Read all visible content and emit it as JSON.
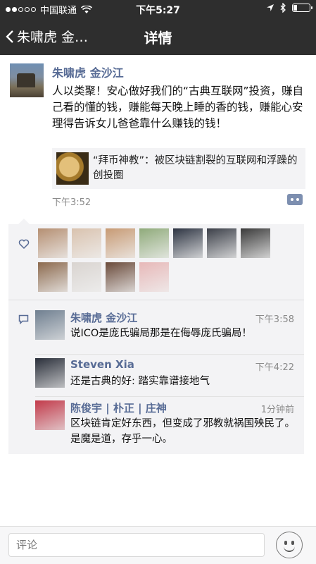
{
  "status_bar": {
    "carrier": "中国联通",
    "time": "下午5:27"
  },
  "nav": {
    "back_label": "朱啸虎 金…",
    "title": "详情"
  },
  "post": {
    "author": "朱啸虎 金沙江",
    "text": "人以类聚！安心做好我们的“古典互联网”投资，赚自己看的懂的钱，赚能每天晚上睡的香的钱，赚能心安理得告诉女儿爸爸靠什么赚钱的钱！",
    "share_title": "“拜币神教”：被区块链割裂的互联网和浮躁的创投圈",
    "time": "下午3:52"
  },
  "likes": {
    "icon": "heart-icon",
    "avatar_colors": [
      [
        "#b58f72",
        "#d9c2ae",
        "#c79a74",
        "#8faa7a",
        "#2d3442",
        "#3b3f48",
        "#3a3a3a"
      ],
      [
        "#8c6a4e",
        "#d9d4d0",
        "#6a4a3a",
        "#e7b8b8"
      ]
    ]
  },
  "comments": [
    {
      "name": "朱啸虎 金沙江",
      "time": "下午3:58",
      "text": "说ICO是庞氏骗局那是在侮辱庞氏骗局！",
      "avatar": "#6f7f90"
    },
    {
      "name": "Steven Xia",
      "time": "下午4:22",
      "text": "还是古典的好: 踏实靠谱接地气",
      "avatar": "#2a2f3a"
    },
    {
      "name": "陈俊宇 | 朴正 | 庄神",
      "time": "1分钟前",
      "text": "区块链肯定好东西，但变成了邪教就祸国殃民了。是魔是道，存乎一心。",
      "avatar": "#c23a4a"
    }
  ],
  "bottom": {
    "placeholder": "评论"
  }
}
